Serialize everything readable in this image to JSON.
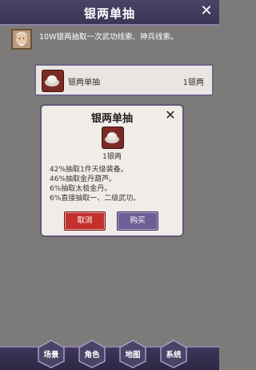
{
  "header": {
    "title": "银两单抽",
    "close_icon": "close-icon"
  },
  "npc": {
    "avatar_icon": "old-man-avatar-icon",
    "text": "10W银两抽取一次武功线索、神兵线索。"
  },
  "item_card": {
    "icon": "silver-ingot-icon",
    "name": "银两单抽",
    "price": "1银两"
  },
  "dialog": {
    "title": "银两单抽",
    "close_icon": "close-icon",
    "item_icon": "silver-ingot-icon",
    "item_label": "1银两",
    "odds": [
      "42%抽取1件天级装备。",
      "46%抽取金丹葫芦。",
      "6%抽取太极金丹。",
      "6%直接抽取一、二级武功。"
    ],
    "cancel_label": "取消",
    "buy_label": "购买"
  },
  "bottom_nav": [
    {
      "label": "场景"
    },
    {
      "label": "角色"
    },
    {
      "label": "地图"
    },
    {
      "label": "系统"
    }
  ],
  "colors": {
    "header": "#3b3556",
    "background": "#7d7b79",
    "cancel": "#c2312e",
    "buy": "#6b5f95"
  }
}
